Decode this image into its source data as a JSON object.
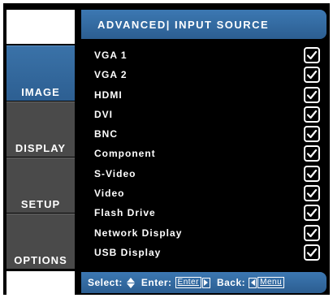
{
  "header": {
    "title": "ADVANCED| INPUT SOURCE"
  },
  "sidebar": {
    "items": [
      {
        "label": "IMAGE",
        "active": true
      },
      {
        "label": "DISPLAY",
        "active": false
      },
      {
        "label": "SETUP",
        "active": false
      },
      {
        "label": "OPTIONS",
        "active": false
      }
    ]
  },
  "sources": [
    {
      "label": "VGA 1",
      "checked": true
    },
    {
      "label": "VGA 2",
      "checked": true
    },
    {
      "label": "HDMI",
      "checked": true
    },
    {
      "label": "DVI",
      "checked": true
    },
    {
      "label": "BNC",
      "checked": true
    },
    {
      "label": "Component",
      "checked": true
    },
    {
      "label": "S-Video",
      "checked": true
    },
    {
      "label": "Video",
      "checked": true
    },
    {
      "label": "Flash Drive",
      "checked": true
    },
    {
      "label": "Network Display",
      "checked": true
    },
    {
      "label": "USB Display",
      "checked": true
    }
  ],
  "footer": {
    "select_label": "Select:",
    "enter_label": "Enter:",
    "enter_key": "Enter",
    "back_label": "Back:",
    "menu_key": "Menu"
  },
  "colors": {
    "accent": "#3c78b2",
    "sidebar_inactive": "#4a4a4a",
    "background": "#000000"
  }
}
